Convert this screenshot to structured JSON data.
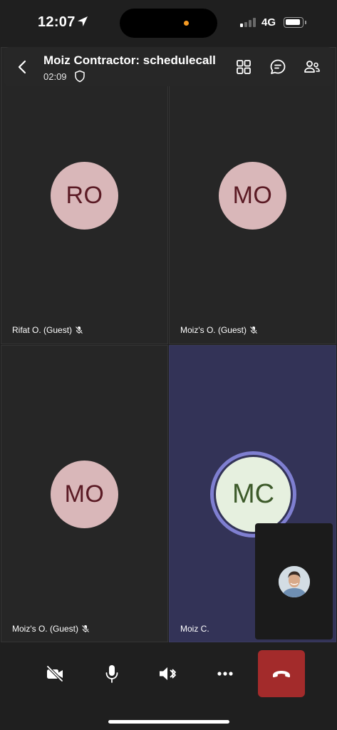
{
  "status_bar": {
    "time": "12:07",
    "network": "4G"
  },
  "header": {
    "title": "Moiz Contractor: schedulecall",
    "duration": "02:09"
  },
  "participants": [
    {
      "initials": "RO",
      "name": "Rifat O. (Guest)",
      "muted": true
    },
    {
      "initials": "MO",
      "name": "Moiz's O. (Guest)",
      "muted": true
    },
    {
      "initials": "MO",
      "name": "Moiz's O. (Guest)",
      "muted": true
    },
    {
      "initials": "MC",
      "name": "Moiz C.",
      "muted": false,
      "speaking": true
    }
  ],
  "colors": {
    "hangup": "#a32b2b",
    "speaking_ring": "#7f7fd1",
    "active_tile": "#333357"
  },
  "controls": [
    "camera-off-icon",
    "microphone-icon",
    "speaker-bluetooth-icon",
    "more-icon",
    "hang-up-icon"
  ]
}
